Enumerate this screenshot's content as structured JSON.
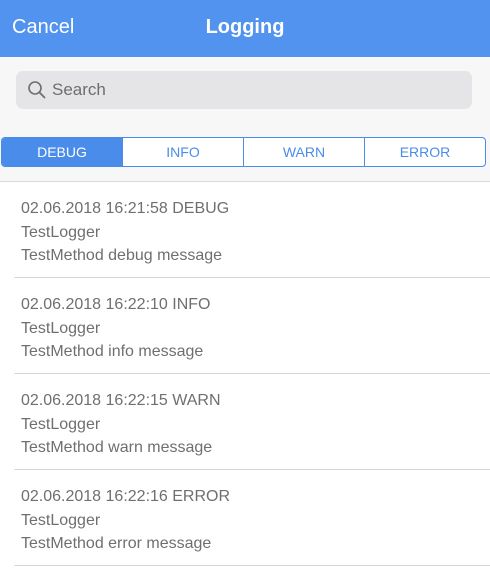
{
  "navbar": {
    "cancel_label": "Cancel",
    "title": "Logging",
    "color": "#5193ee"
  },
  "search": {
    "placeholder": "Search",
    "value": ""
  },
  "segments": [
    {
      "label": "DEBUG",
      "selected": true
    },
    {
      "label": "INFO",
      "selected": false
    },
    {
      "label": "WARN",
      "selected": false
    },
    {
      "label": "ERROR",
      "selected": false
    }
  ],
  "logs": [
    {
      "header": "02.06.2018 16:21:58 DEBUG",
      "logger": "TestLogger",
      "message": "TestMethod debug message"
    },
    {
      "header": "02.06.2018 16:22:10 INFO",
      "logger": "TestLogger",
      "message": "TestMethod info message"
    },
    {
      "header": "02.06.2018 16:22:15 WARN",
      "logger": "TestLogger",
      "message": "TestMethod warn message"
    },
    {
      "header": "02.06.2018 16:22:16 ERROR",
      "logger": "TestLogger",
      "message": "TestMethod error message"
    }
  ],
  "colors": {
    "accent": "#4a8cea",
    "text": "#6f6f6f"
  }
}
